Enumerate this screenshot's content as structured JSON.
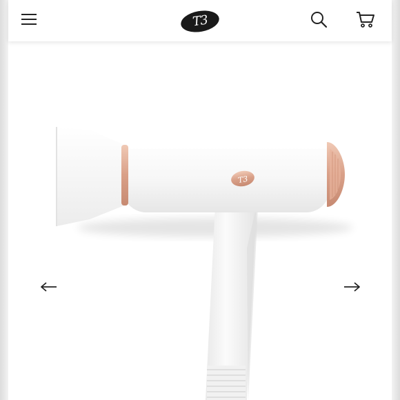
{
  "header": {
    "brand": "T3",
    "icons": {
      "menu": "hamburger-menu-icon",
      "search": "search-icon",
      "cart": "cart-icon"
    }
  },
  "gallery": {
    "product_logo": "T3",
    "prev_icon": "arrow-left-icon",
    "next_icon": "arrow-right-icon"
  },
  "colors": {
    "accent_rose_gold": "#d9a088",
    "logo_fill": "#1a1a1a",
    "background": "#ffffff"
  }
}
